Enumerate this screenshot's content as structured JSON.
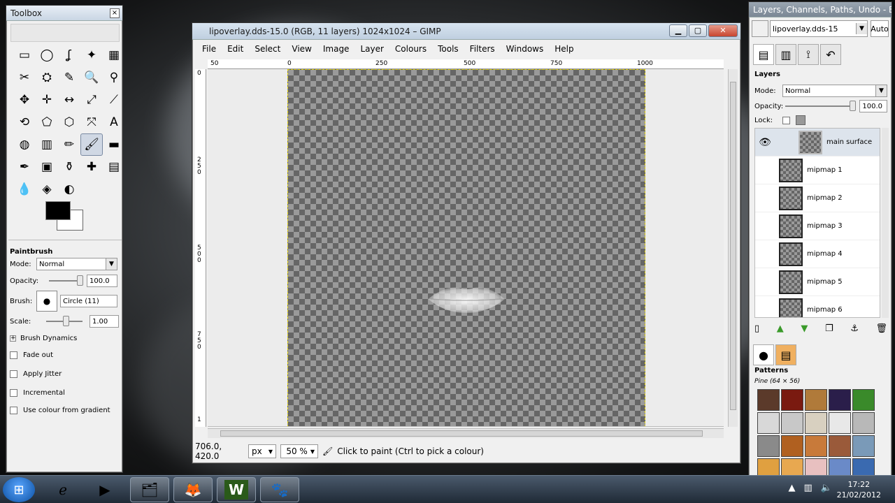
{
  "toolbox": {
    "title": "Toolbox",
    "close": "×",
    "tools": [
      "▭",
      "◯",
      "ʆ",
      "✦",
      "▦",
      "✂",
      "⛭",
      "✎",
      "🔍",
      "⚲",
      "✥",
      "✛",
      "↔",
      "⤢",
      "⟋",
      "⟲",
      "⬠",
      "⬡",
      "⤧",
      "A",
      "◍",
      "▥",
      "✏",
      "🖌",
      "▬",
      "✒",
      "▣",
      "⚱",
      "✚",
      "▤",
      "💧",
      "◈",
      "◐"
    ],
    "tool_options": {
      "title": "Paintbrush",
      "mode_label": "Mode:",
      "mode_value": "Normal",
      "opacity_label": "Opacity:",
      "opacity_value": "100.0",
      "brush_label": "Brush:",
      "brush_value": "Circle (11)",
      "scale_label": "Scale:",
      "scale_value": "1.00",
      "brush_dynamics": "Brush Dynamics",
      "fade_out": "Fade out",
      "apply_jitter": "Apply Jitter",
      "incremental": "Incremental",
      "use_colour_gradient": "Use colour from gradient"
    }
  },
  "main": {
    "title": "lipoverlay.dds-15.0 (RGB, 11 layers) 1024x1024 – GIMP",
    "menus": [
      {
        "label": "File"
      },
      {
        "label": "Edit"
      },
      {
        "label": "Select"
      },
      {
        "label": "View"
      },
      {
        "label": "Image"
      },
      {
        "label": "Layer"
      },
      {
        "label": "Colours"
      },
      {
        "label": "Tools"
      },
      {
        "label": "Filters"
      },
      {
        "label": "Windows"
      },
      {
        "label": "Help"
      }
    ],
    "ruler_h": [
      "50",
      "0",
      "250",
      "500",
      "750",
      "1000"
    ],
    "ruler_v": [
      "0",
      "2 5 0",
      "5 0 0",
      "7 5 0",
      "1"
    ],
    "status": {
      "coords": "706.0, 420.0",
      "unit": "px",
      "zoom": "50 %",
      "message": "Click to paint (Ctrl to pick a colour)"
    }
  },
  "dock": {
    "title": "Layers, Channels, Paths, Undo - B...",
    "image_select": "lipoverlay.dds-15",
    "auto_label": "Auto",
    "layers": {
      "title": "Layers",
      "mode_label": "Mode:",
      "mode_value": "Normal",
      "opacity_label": "Opacity:",
      "opacity_value": "100.0",
      "lock_label": "Lock:",
      "items": [
        {
          "name": "main surface"
        },
        {
          "name": "mipmap 1"
        },
        {
          "name": "mipmap 2"
        },
        {
          "name": "mipmap 3"
        },
        {
          "name": "mipmap 4"
        },
        {
          "name": "mipmap 5"
        },
        {
          "name": "mipmap 6"
        }
      ]
    },
    "patterns": {
      "title": "Patterns",
      "current": "Pine (64 × 56)",
      "swatches": [
        "#5b3a2a",
        "#7a1a10",
        "#b07a3a",
        "#2a1e4a",
        "#3a8a2a",
        "#d8d8d8",
        "#c8c8c8",
        "#d8d0c0",
        "#e8e8e8",
        "#b8b8b8",
        "#8a8a8a",
        "#b06020",
        "#c87a3a",
        "#9a5a3a",
        "#7a9ab8",
        "#e0a040",
        "#e8a850",
        "#e8c0c0",
        "#6a8ac8",
        "#3a6ab0"
      ]
    }
  },
  "taskbar": {
    "clock_time": "17:22",
    "clock_date": "21/02/2012"
  }
}
